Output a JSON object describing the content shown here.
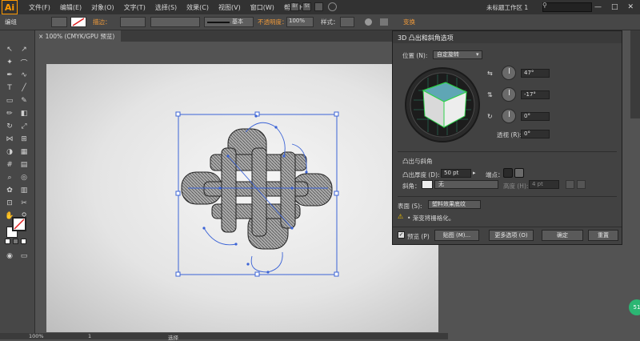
{
  "app": {
    "logo": "Ai",
    "workspace": "未标题工作区 1"
  },
  "menu": [
    "文件(F)",
    "编辑(E)",
    "对象(O)",
    "文字(T)",
    "选择(S)",
    "效果(C)",
    "视图(V)",
    "窗口(W)",
    "帮助(H)"
  ],
  "window_controls": [
    "—",
    "□",
    "✕"
  ],
  "control_bar": {
    "label": "编组",
    "stroke_label": "描边：",
    "stroke_style": "基本",
    "opacity_label": "不透明度：",
    "opacity_value": "100%",
    "style_label": "样式：",
    "transform_label": "变换"
  },
  "document_tab": {
    "title": "× 100% (CMYK/GPU 预览)"
  },
  "status_bar": {
    "zoom": "100%",
    "page": "1",
    "tool": "选择"
  },
  "dialog": {
    "title": "3D 凸出和斜角选项",
    "position_label": "位置 (N):",
    "position_value": "自定旋转",
    "rot_x": "47°",
    "rot_y": "-17°",
    "rot_z": "0°",
    "perspective_label": "透视 (R):",
    "perspective_value": "0°",
    "extrude_section": "凸出与斜角",
    "extrude_depth_label": "凸出厚度 (D):",
    "extrude_depth_value": "50 pt",
    "cap_label": "端点：",
    "bevel_label": "斜角：",
    "bevel_value": "无",
    "height_label": "高度 (H):",
    "height_value": "4 pt",
    "surface_label": "表面 (S):",
    "surface_value": "塑料效果底纹",
    "warning_text": "• 渐变将栅格化。",
    "preview_label": "预览 (P)",
    "map_button": "贴图 (M)...",
    "more_button": "更多选项 (O)",
    "ok_button": "确定",
    "reset_button": "重置"
  },
  "colors": {
    "accent": "#ff9a00",
    "cube_top": "#5fa6b5",
    "cube_edges": "#2fd14a",
    "selection": "#3b63d6"
  }
}
